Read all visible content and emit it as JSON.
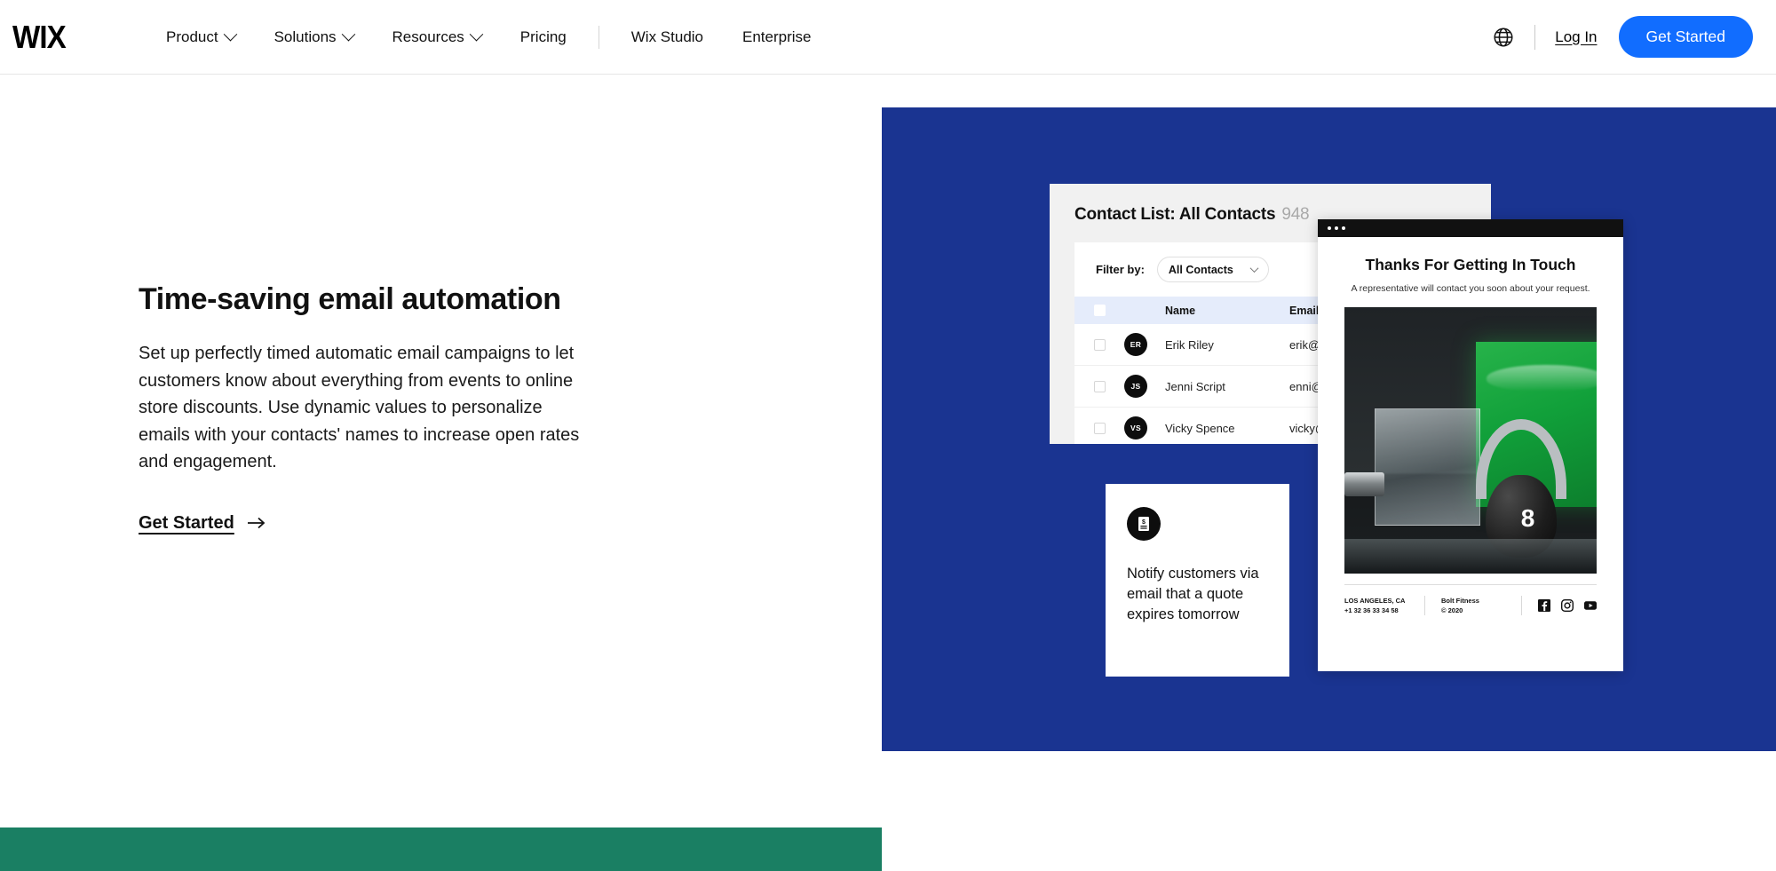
{
  "header": {
    "logo": "WIX",
    "nav": [
      {
        "label": "Product",
        "caret": true
      },
      {
        "label": "Solutions",
        "caret": true
      },
      {
        "label": "Resources",
        "caret": true
      },
      {
        "label": "Pricing",
        "caret": false
      },
      {
        "label": "Wix Studio",
        "caret": false
      },
      {
        "label": "Enterprise",
        "caret": false
      }
    ],
    "globe_icon": "globe-icon",
    "login_label": "Log In",
    "cta_label": "Get Started",
    "cta_color": "#116dff"
  },
  "hero": {
    "title": "Time-saving email automation",
    "body": "Set up perfectly timed automatic email campaigns to let customers know about everything from events to online store discounts. Use dynamic values to personalize emails with your contacts' names to increase open rates and engagement.",
    "link_label": "Get Started",
    "link_arrow": "arrow-right-icon"
  },
  "panel": {
    "background_color": "#1a3491",
    "accent_strip_color": "#1a7f63"
  },
  "contact_list": {
    "title": "Contact List: All Contacts",
    "count": "948",
    "filter_label": "Filter by:",
    "filter_value": "All Contacts",
    "columns": [
      "Name",
      "Email"
    ],
    "rows": [
      {
        "initials": "ER",
        "name": "Erik Riley",
        "email": "erik@mail.com"
      },
      {
        "initials": "JS",
        "name": "Jenni Script",
        "email": "enni@mail.com"
      },
      {
        "initials": "VS",
        "name": "Vicky Spence",
        "email": "vicky@mail.com"
      }
    ]
  },
  "notify_card": {
    "icon": "invoice-icon",
    "text": "Notify customers via email that a quote expires tomorrow"
  },
  "email_preview": {
    "window_dots": 3,
    "heading": "Thanks For Getting In Touch",
    "subheading": "A representative will contact you soon about your request.",
    "photo_alt": "kettlebell-product-photo",
    "kettlebell_weight": "8",
    "footer": {
      "location": "LOS ANGELES, CA",
      "phone": "+1 32 36 33 34 58",
      "brand": "Bolt Fitness",
      "copyright": "© 2020",
      "social": [
        "facebook-icon",
        "instagram-icon",
        "youtube-icon"
      ]
    }
  }
}
